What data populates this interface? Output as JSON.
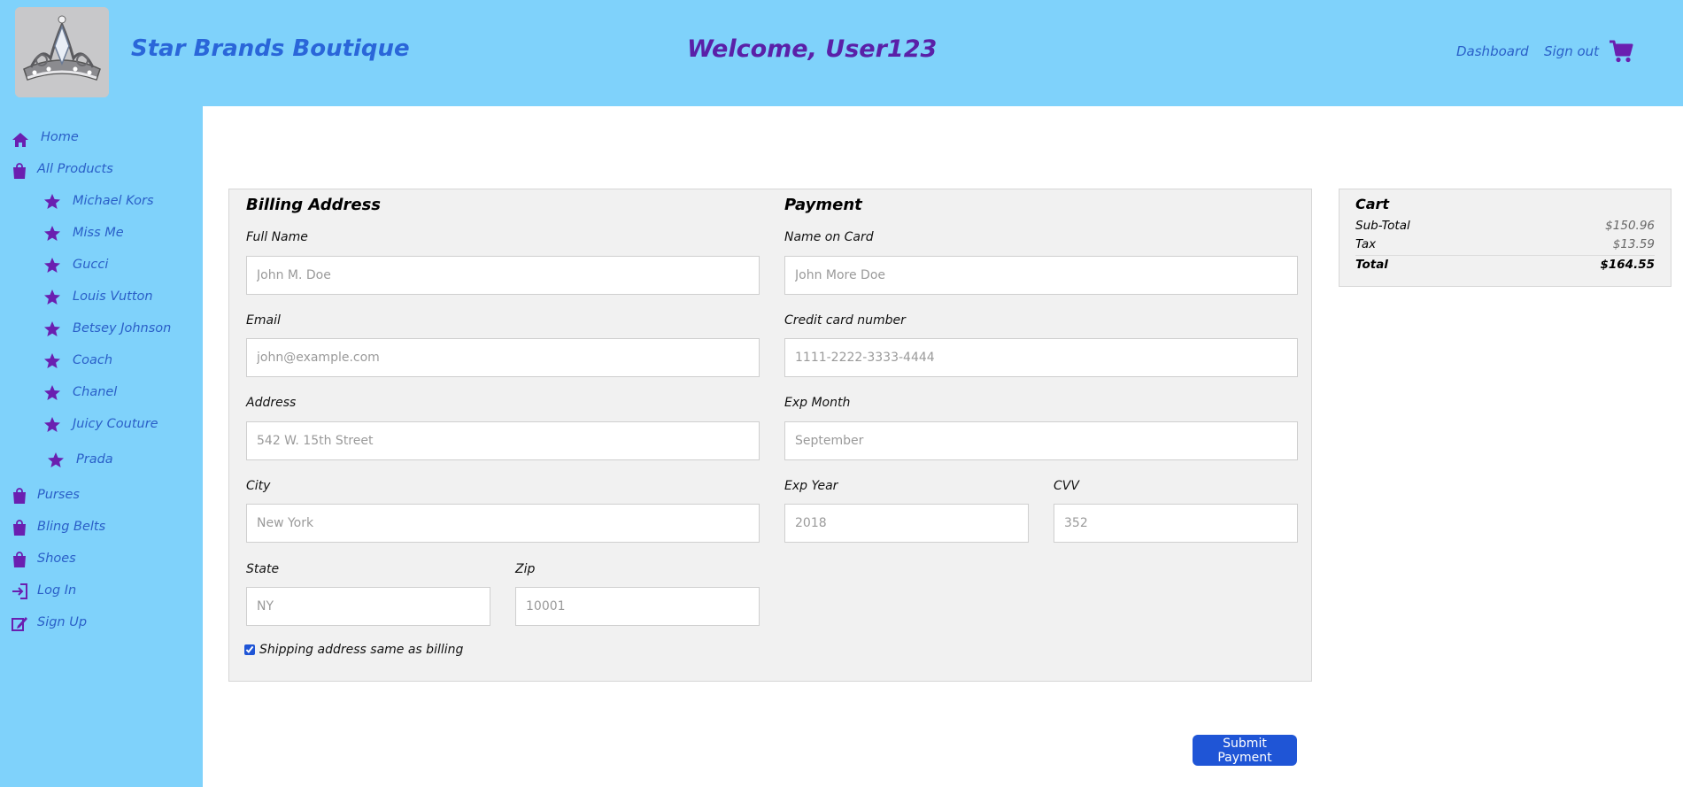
{
  "header": {
    "brand": "Star Brands Boutique",
    "welcome": "Welcome, User123",
    "dashboard_label": "Dashboard",
    "signout_label": "Sign out",
    "cart_icon": "shopping-cart-icon"
  },
  "sidebar": {
    "items": [
      {
        "label": "Home",
        "icon": "home-icon"
      },
      {
        "label": "All Products",
        "icon": "shopping-bag-icon"
      },
      {
        "label": "Michael Kors",
        "icon": "star-icon"
      },
      {
        "label": "Miss Me",
        "icon": "star-icon"
      },
      {
        "label": "Gucci",
        "icon": "star-icon"
      },
      {
        "label": "Louis Vutton",
        "icon": "star-icon"
      },
      {
        "label": "Betsey Johnson",
        "icon": "star-icon"
      },
      {
        "label": "Coach",
        "icon": "star-icon"
      },
      {
        "label": "Chanel",
        "icon": "star-icon"
      },
      {
        "label": "Juicy Couture",
        "icon": "star-icon"
      },
      {
        "label": "Prada",
        "icon": "star-icon"
      },
      {
        "label": "Purses",
        "icon": "shopping-bag-icon"
      },
      {
        "label": "Bling Belts",
        "icon": "shopping-bag-icon"
      },
      {
        "label": "Shoes",
        "icon": "shopping-bag-icon"
      },
      {
        "label": "Log In",
        "icon": "login-icon"
      },
      {
        "label": "Sign Up",
        "icon": "signup-icon"
      }
    ]
  },
  "billing": {
    "title": "Billing Address",
    "full_name_label": "Full Name",
    "full_name_placeholder": "John M. Doe",
    "email_label": "Email",
    "email_placeholder": "john@example.com",
    "address_label": "Address",
    "address_placeholder": "542 W. 15th Street",
    "city_label": "City",
    "city_placeholder": "New York",
    "state_label": "State",
    "state_placeholder": "NY",
    "zip_label": "Zip",
    "zip_placeholder": "10001",
    "same_as_billing_label": "Shipping address same as billing",
    "same_as_billing_checked": true
  },
  "payment": {
    "title": "Payment",
    "name_on_card_label": "Name on Card",
    "name_on_card_placeholder": "John More Doe",
    "card_number_label": "Credit card number",
    "card_number_placeholder": "1111-2222-3333-4444",
    "exp_month_label": "Exp Month",
    "exp_month_placeholder": "September",
    "exp_year_label": "Exp Year",
    "exp_year_placeholder": "2018",
    "cvv_label": "CVV",
    "cvv_placeholder": "352"
  },
  "cart": {
    "title": "Cart",
    "subtotal_label": "Sub-Total",
    "subtotal_value": "$150.96",
    "tax_label": "Tax",
    "tax_value": "$13.59",
    "total_label": "Total",
    "total_value": "$164.55"
  },
  "submit_label": "Submit Payment",
  "colors": {
    "header_bg": "#7fd2fb",
    "brand": "#2a66d9",
    "accent_purple": "#6a1fb0",
    "button": "#1f55d6"
  }
}
